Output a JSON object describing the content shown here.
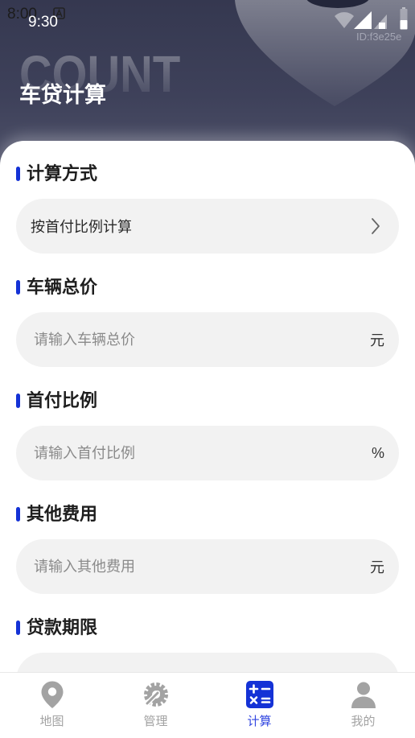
{
  "status_bar": {
    "system_time": "8:00",
    "app_time": "9:30",
    "device_id": "ID:f3e25e",
    "icons": [
      "a-notification-icon",
      "wifi-icon",
      "signal-icon",
      "signal-secondary-icon",
      "battery-icon"
    ]
  },
  "header": {
    "watermark": "COUNT",
    "title": "车贷计算"
  },
  "form": {
    "sections": [
      {
        "label": "计算方式",
        "value": "按首付比例计算",
        "trailing_icon": "chevron-right-icon"
      },
      {
        "label": "车辆总价",
        "placeholder": "请输入车辆总价",
        "suffix": "元"
      },
      {
        "label": "首付比例",
        "placeholder": "请输入首付比例",
        "suffix": "%"
      },
      {
        "label": "其他费用",
        "placeholder": "请输入其他费用",
        "suffix": "元"
      },
      {
        "label": "贷款期限"
      }
    ]
  },
  "nav": {
    "active_index": 2,
    "items": [
      {
        "label": "地图",
        "icon": "map-pin-icon"
      },
      {
        "label": "管理",
        "icon": "gear-wrench-icon"
      },
      {
        "label": "计算",
        "icon": "calculator-icon"
      },
      {
        "label": "我的",
        "icon": "person-icon"
      }
    ]
  },
  "colors": {
    "accent": "#1432d6",
    "nav_active": "#3146e0",
    "nav_inactive": "#a3a3a3",
    "header_bg": "#3c3f58",
    "field_bg": "#f2f2f2"
  }
}
